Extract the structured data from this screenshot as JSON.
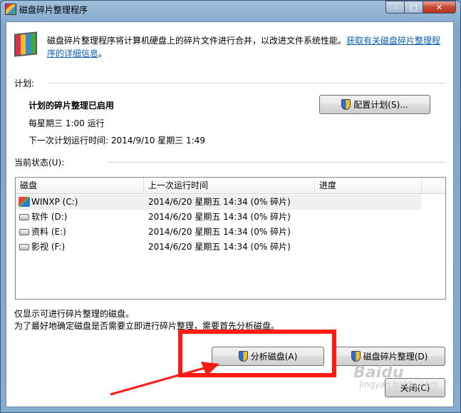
{
  "window": {
    "title": "磁盘碎片整理程序",
    "controls": {
      "minimize": "–",
      "maximize": "□",
      "close": "✕"
    }
  },
  "intro": {
    "text": "磁盘碎片整理程序将计算机硬盘上的碎片文件进行合并，以改进文件系统性能。",
    "link": "获取有关磁盘碎片整理程序的详细信息",
    "after": "。"
  },
  "schedule": {
    "section_label": "计划:",
    "status": "计划的碎片整理已启用",
    "frequency": "每星期三  1:00 运行",
    "next_run": "下一次计划运行时间: 2014/9/10 星期三 1:49",
    "configure_button": "配置计划(S)..."
  },
  "current_status": {
    "section_label": "当前状态(U):",
    "columns": [
      "磁盘",
      "上一次运行时间",
      "进度"
    ],
    "rows": [
      {
        "disk": "WINXP (C:)",
        "last_run": "2014/6/20 星期五 14:34 (0% 碎片)",
        "progress": "",
        "icon": "windows-drive-icon",
        "selected": true
      },
      {
        "disk": "软件 (D:)",
        "last_run": "2014/6/20 星期五 14:34 (0% 碎片)",
        "progress": "",
        "icon": "hard-drive-icon",
        "selected": false
      },
      {
        "disk": "资料 (E:)",
        "last_run": "2014/6/20 星期五 14:34 (0% 碎片)",
        "progress": "",
        "icon": "hard-drive-icon",
        "selected": false
      },
      {
        "disk": "影视 (F:)",
        "last_run": "2014/6/20 星期五 14:34 (0% 碎片)",
        "progress": "",
        "icon": "hard-drive-icon",
        "selected": false
      }
    ]
  },
  "notes": {
    "line1": "仅显示可进行碎片整理的磁盘。",
    "line2": "为了最好地确定磁盘是否需要立即进行碎片整理，需要首先分析磁盘。"
  },
  "buttons": {
    "analyze": "分析磁盘(A)",
    "defragment": "磁盘碎片整理(D)",
    "close": "关闭(C)"
  },
  "annotation": {
    "highlight_color": "#ff1a12"
  },
  "watermark": {
    "brand": "Baidu",
    "sub": "jingyan.baidu.com"
  }
}
